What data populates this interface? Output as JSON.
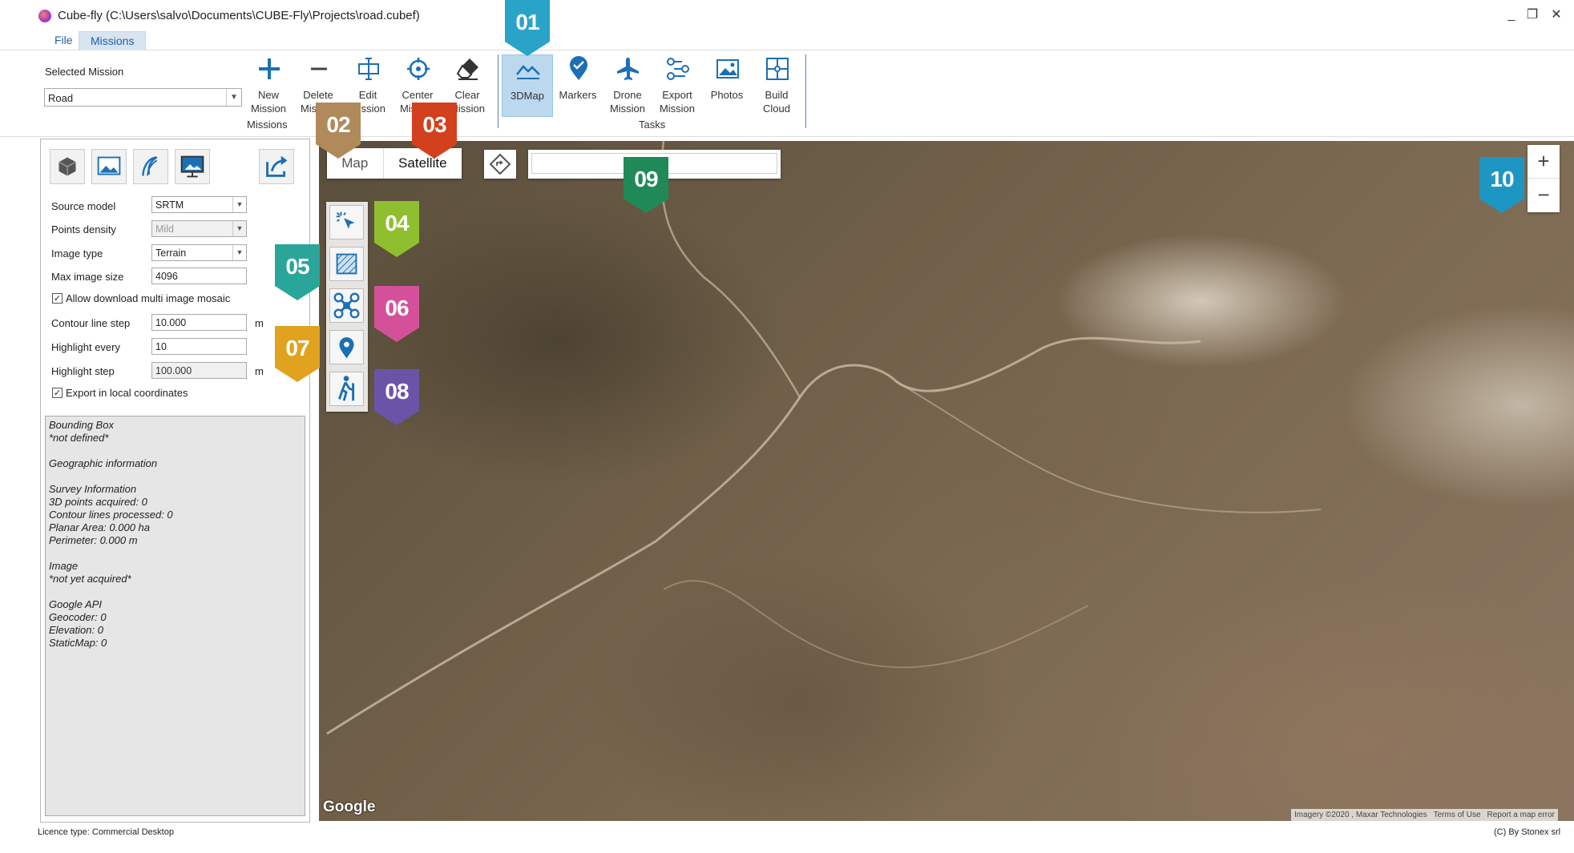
{
  "window": {
    "title": "Cube-fly (C:\\Users\\salvo\\Documents\\CUBE-Fly\\Projects\\road.cubef)",
    "minimize": "_",
    "restore": "❐",
    "close": "✕"
  },
  "menu": {
    "tabs": [
      {
        "label": "File"
      },
      {
        "label": "Missions"
      }
    ]
  },
  "ribbon": {
    "selected_mission_label": "Selected Mission",
    "selected_mission_value": "Road",
    "groups": {
      "missions": "Missions",
      "tasks": "Tasks"
    },
    "buttons": {
      "new_mission": "New\nMission",
      "delete_mission": "Delete\nMission",
      "edit_mission": "Edit\nMission",
      "center_mission": "Center\nMission",
      "clear_mission": "Clear\nMission",
      "map3d": "3DMap",
      "markers": "Markers",
      "drone_mission": "Drone\nMission",
      "export_mission": "Export\nMission",
      "photos": "Photos",
      "build_cloud": "Build\nCloud"
    }
  },
  "panel": {
    "source_model": {
      "label": "Source model",
      "value": "SRTM"
    },
    "points_density": {
      "label": "Points density",
      "value": "Mild"
    },
    "image_type": {
      "label": "Image type",
      "value": "Terrain"
    },
    "max_image_size": {
      "label": "Max image size",
      "value": "4096"
    },
    "allow_mosaic": {
      "label": "Allow download multi image mosaic",
      "checked": true
    },
    "contour_line_step": {
      "label": "Contour line step",
      "value": "10.000",
      "unit": "m"
    },
    "highlight_every": {
      "label": "Highlight every",
      "value": "10"
    },
    "highlight_step": {
      "label": "Highlight step",
      "value": "100.000",
      "unit": "m"
    },
    "export_local": {
      "label": "Export in local coordinates",
      "checked": true
    },
    "info_lines": [
      "Bounding Box",
      "*not defined*",
      "",
      "Geographic information",
      "",
      "Survey Information",
      "3D points acquired: 0",
      "Contour lines processed: 0",
      "Planar Area: 0.000 ha",
      "Perimeter: 0.000 m",
      "",
      "Image",
      "*not yet acquired*",
      "",
      "Google API",
      "Geocoder: 0",
      "Elevation: 0",
      "StaticMap: 0"
    ]
  },
  "map": {
    "type_map": "Map",
    "type_satellite": "Satellite",
    "search_placeholder": "",
    "zoom_in": "+",
    "zoom_out": "−",
    "google_logo": "Google",
    "attribution": {
      "imagery": "Imagery ©2020 , Maxar Technologies",
      "terms": "Terms of Use",
      "report": "Report a map error"
    }
  },
  "callouts": [
    {
      "label": "01",
      "color": "#2aa3c8"
    },
    {
      "label": "02",
      "color": "#b08a5a"
    },
    {
      "label": "03",
      "color": "#d2401e"
    },
    {
      "label": "04",
      "color": "#8fbf2e"
    },
    {
      "label": "05",
      "color": "#2aa59a"
    },
    {
      "label": "06",
      "color": "#d4519a"
    },
    {
      "label": "07",
      "color": "#e0a21f"
    },
    {
      "label": "08",
      "color": "#6a54a8"
    },
    {
      "label": "09",
      "color": "#1f8a57"
    },
    {
      "label": "10",
      "color": "#1e96c4"
    }
  ],
  "status": {
    "licence": "Licence type: Commercial Desktop",
    "copyright": "(C) By Stonex srl"
  },
  "colors": {
    "accent_blue": "#1b6fb5",
    "active_tab": "#bcd8ef"
  }
}
